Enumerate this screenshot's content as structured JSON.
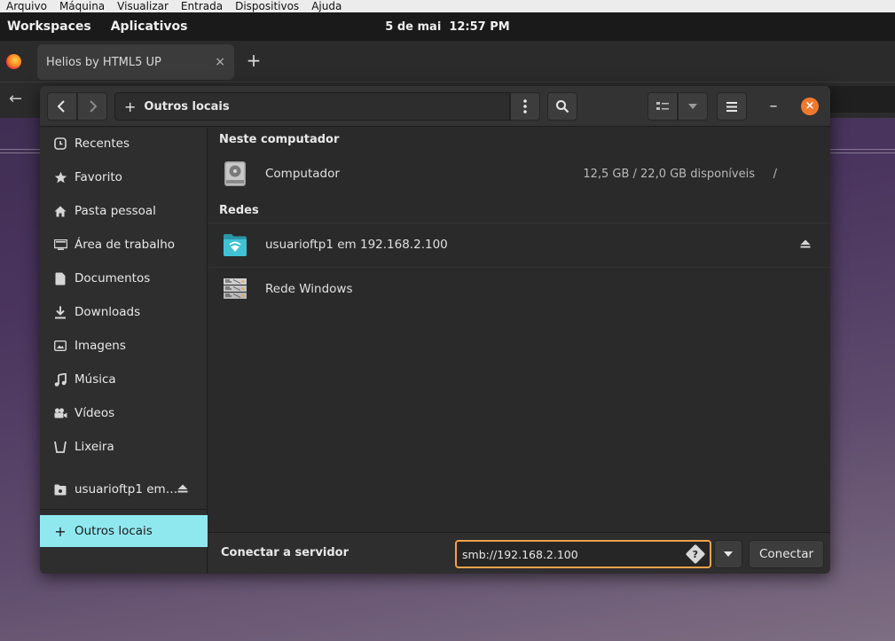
{
  "vm_menu": [
    "Arquivo",
    "Máquina",
    "Visualizar",
    "Entrada",
    "Dispositivos",
    "Ajuda"
  ],
  "panel": {
    "workspaces": "Workspaces",
    "apps": "Aplicativos",
    "date": "5 de mai",
    "time": "12:57 PM"
  },
  "browser": {
    "tab_title": "Helios by HTML5 UP",
    "tab_close": "×",
    "new_tab": "+",
    "back": "←"
  },
  "dialog": {
    "path_plus": "+",
    "path_label": "Outros locais",
    "minimize": "–",
    "close": "×"
  },
  "sidebar": {
    "items": [
      {
        "label": "Recentes",
        "icon": "clock-icon"
      },
      {
        "label": "Favorito",
        "icon": "star-icon"
      },
      {
        "label": "Pasta pessoal",
        "icon": "home-icon"
      },
      {
        "label": "Área de trabalho",
        "icon": "desktop-icon"
      },
      {
        "label": "Documentos",
        "icon": "document-icon"
      },
      {
        "label": "Downloads",
        "icon": "download-icon"
      },
      {
        "label": "Imagens",
        "icon": "image-icon"
      },
      {
        "label": "Música",
        "icon": "music-icon"
      },
      {
        "label": "Vídeos",
        "icon": "video-icon"
      },
      {
        "label": "Lixeira",
        "icon": "trash-icon"
      }
    ],
    "mount": {
      "label": "usuarioftp1 em…",
      "icon": "network-folder-icon"
    },
    "other": {
      "label": "Outros locais",
      "plus": "+"
    }
  },
  "main": {
    "section_computer": "Neste computador",
    "computer": {
      "name": "Computador",
      "space": "12,5 GB / 22,0 GB disponíveis",
      "path": "/"
    },
    "section_networks": "Redes",
    "network_items": [
      {
        "name": "usuarioftp1 em 192.168.2.100",
        "icon": "network-folder-icon"
      },
      {
        "name": "Rede Windows",
        "icon": "server-icon"
      }
    ]
  },
  "connect": {
    "label": "Conectar a servidor",
    "value": "smb://192.168.2.100",
    "help": "?",
    "button": "Conectar"
  },
  "colors": {
    "accent_selected": "#90e8ef",
    "close_button": "#f0782d",
    "input_focus": "#f0a24a",
    "network_folder": "#36b3c4"
  }
}
